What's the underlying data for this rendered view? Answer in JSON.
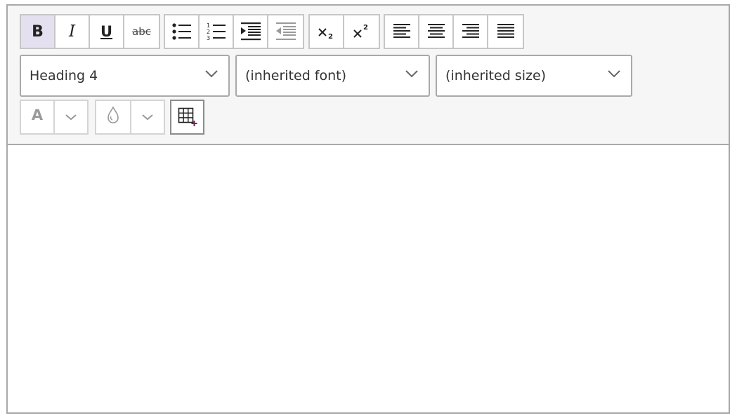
{
  "toolbar": {
    "buttons": {
      "bold": "B",
      "italic": "I",
      "underline": "U",
      "strikethrough": "abc",
      "font_color": "A"
    },
    "style_select": {
      "value": "Heading 4"
    },
    "font_select": {
      "value": "(inherited font)"
    },
    "size_select": {
      "value": "(inherited size)"
    }
  },
  "colors": {
    "border": "#a9a9a9",
    "toolbar_bg": "#f6f6f6",
    "active_button_bg": "#e4e0ef",
    "icon": "#222222",
    "disabled_icon": "#9a9a9a",
    "table_icon_accent": "#7a1e5a"
  },
  "icons": [
    "bulleted-list-icon",
    "numbered-list-icon",
    "indent-icon",
    "outdent-icon",
    "subscript-icon",
    "superscript-icon",
    "align-left-icon",
    "align-center-icon",
    "align-right-icon",
    "justify-icon",
    "font-color-icon",
    "highlight-drop-icon",
    "insert-table-icon",
    "chevron-down-icon"
  ]
}
